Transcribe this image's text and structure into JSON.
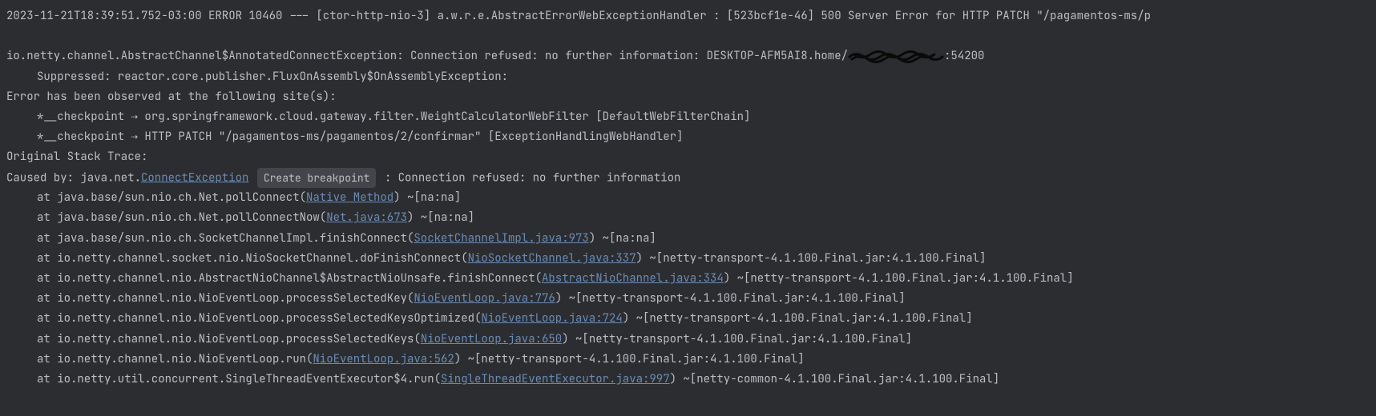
{
  "header_line": "2023-11-21T18:39:51.752-03:00 ERROR 10460 --- [ctor-http-nio-3] a.w.r.e.AbstractErrorWebExceptionHandler : [523bcf1e-46]  500 Server Error for HTTP PATCH \"/pagamentos-ms/p",
  "exception_line_prefix": "io.netty.channel.AbstractChannel$AnnotatedConnectException: Connection refused: no further information: DESKTOP-AFM5AI8.home/",
  "exception_line_suffix": ":54200",
  "suppressed_line": "Suppressed: reactor.core.publisher.FluxOnAssembly$OnAssemblyException:",
  "observed_line": "Error has been observed at the following site(s):",
  "checkpoint1": "*__checkpoint ⇢ org.springframework.cloud.gateway.filter.WeightCalculatorWebFilter [DefaultWebFilterChain]",
  "checkpoint2": "*__checkpoint ⇢ HTTP PATCH \"/pagamentos-ms/pagamentos/2/confirmar\" [ExceptionHandlingWebHandler]",
  "original_trace": "Original Stack Trace:",
  "caused_by_prefix": "Caused by: java.net.",
  "caused_by_exception": "ConnectException",
  "create_breakpoint_label": "Create breakpoint",
  "caused_by_suffix": " : Connection refused: no further information",
  "stack": [
    {
      "prefix": "at java.base/sun.nio.ch.Net.pollConnect(",
      "link": "Native Method",
      "suffix": ") ~[na:na]"
    },
    {
      "prefix": "at java.base/sun.nio.ch.Net.pollConnectNow(",
      "link": "Net.java:673",
      "suffix": ") ~[na:na]"
    },
    {
      "prefix": "at java.base/sun.nio.ch.SocketChannelImpl.finishConnect(",
      "link": "SocketChannelImpl.java:973",
      "suffix": ") ~[na:na]"
    },
    {
      "prefix": "at io.netty.channel.socket.nio.NioSocketChannel.doFinishConnect(",
      "link": "NioSocketChannel.java:337",
      "suffix": ") ~[netty-transport-4.1.100.Final.jar:4.1.100.Final]"
    },
    {
      "prefix": "at io.netty.channel.nio.AbstractNioChannel$AbstractNioUnsafe.finishConnect(",
      "link": "AbstractNioChannel.java:334",
      "suffix": ") ~[netty-transport-4.1.100.Final.jar:4.1.100.Final]"
    },
    {
      "prefix": "at io.netty.channel.nio.NioEventLoop.processSelectedKey(",
      "link": "NioEventLoop.java:776",
      "suffix": ") ~[netty-transport-4.1.100.Final.jar:4.1.100.Final]"
    },
    {
      "prefix": "at io.netty.channel.nio.NioEventLoop.processSelectedKeysOptimized(",
      "link": "NioEventLoop.java:724",
      "suffix": ") ~[netty-transport-4.1.100.Final.jar:4.1.100.Final]"
    },
    {
      "prefix": "at io.netty.channel.nio.NioEventLoop.processSelectedKeys(",
      "link": "NioEventLoop.java:650",
      "suffix": ") ~[netty-transport-4.1.100.Final.jar:4.1.100.Final]"
    },
    {
      "prefix": "at io.netty.channel.nio.NioEventLoop.run(",
      "link": "NioEventLoop.java:562",
      "suffix": ") ~[netty-transport-4.1.100.Final.jar:4.1.100.Final]"
    },
    {
      "prefix": "at io.netty.util.concurrent.SingleThreadEventExecutor$4.run(",
      "link": "SingleThreadEventExecutor.java:997",
      "suffix": ") ~[netty-common-4.1.100.Final.jar:4.1.100.Final]"
    }
  ]
}
